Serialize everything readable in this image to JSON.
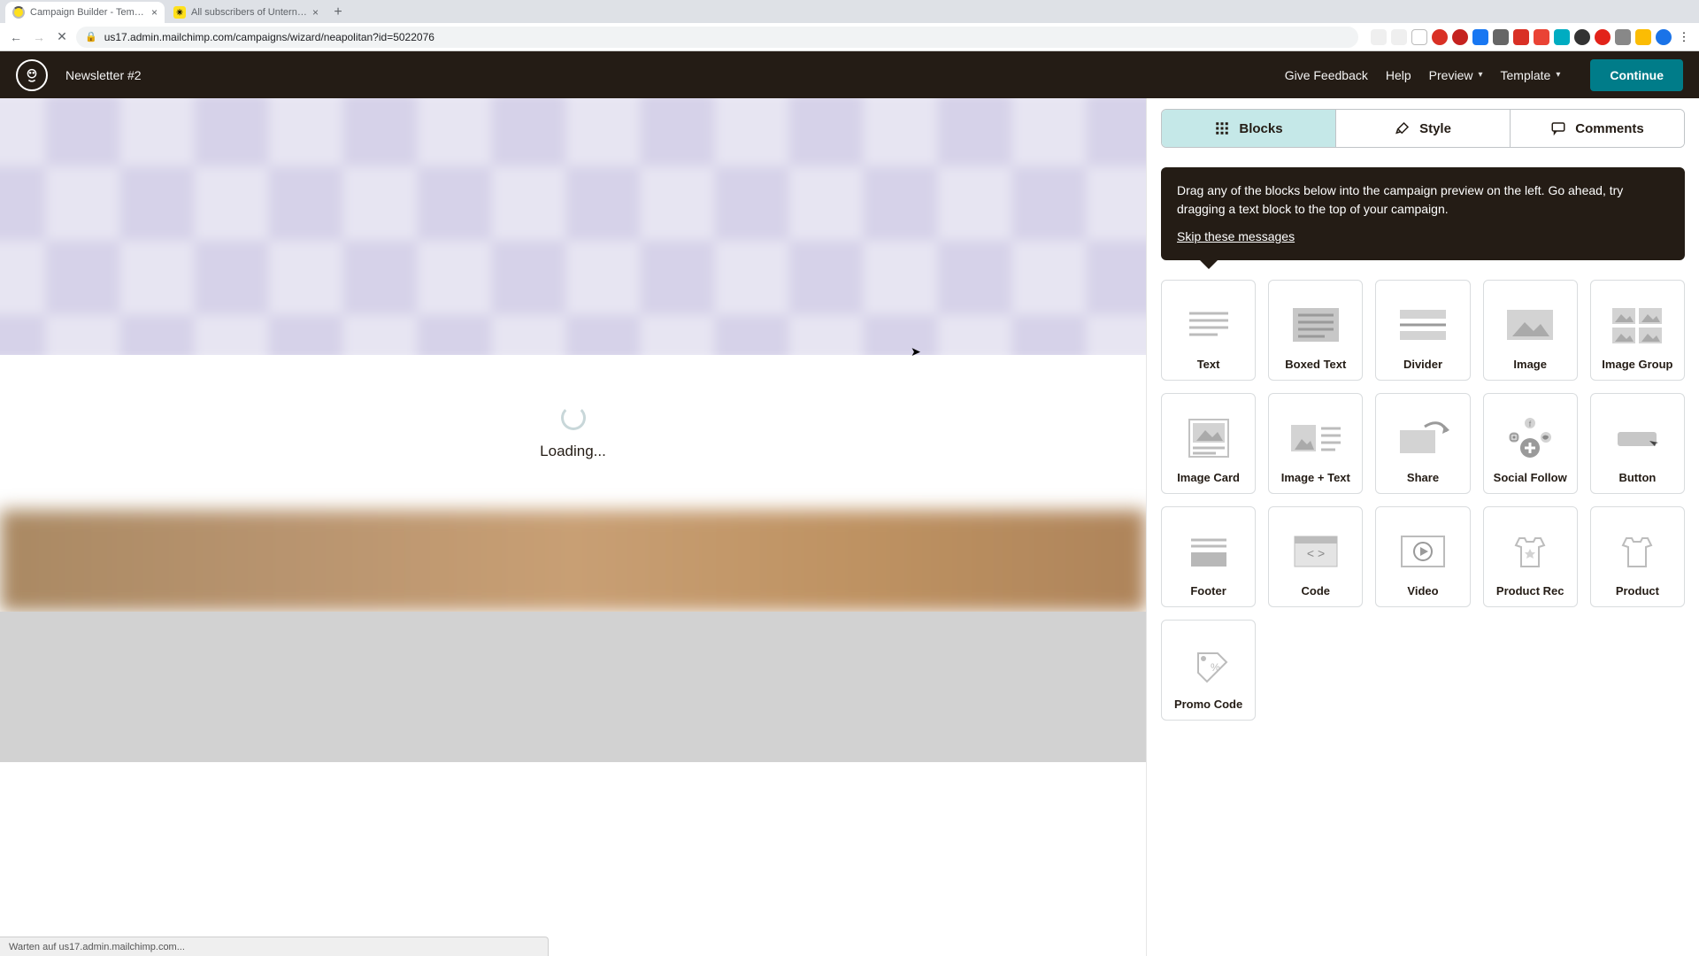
{
  "browser": {
    "tabs": [
      {
        "title": "Campaign Builder - Template D",
        "loading": true
      },
      {
        "title": "All subscribers of Unternehme",
        "loading": false
      }
    ],
    "url": "us17.admin.mailchimp.com/campaigns/wizard/neapolitan?id=5022076",
    "status_text": "Warten auf us17.admin.mailchimp.com..."
  },
  "header": {
    "doc_title": "Newsletter #2",
    "give_feedback": "Give Feedback",
    "help": "Help",
    "preview": "Preview",
    "template": "Template",
    "continue": "Continue"
  },
  "panel": {
    "tabs": {
      "blocks": "Blocks",
      "style": "Style",
      "comments": "Comments"
    },
    "tooltip_text": "Drag any of the blocks below into the campaign preview on the left. Go ahead, try dragging a text block to the top of your campaign.",
    "skip": "Skip these messages"
  },
  "preview": {
    "loading": "Loading..."
  },
  "blocks": [
    {
      "id": "text",
      "label": "Text"
    },
    {
      "id": "boxed-text",
      "label": "Boxed Text"
    },
    {
      "id": "divider",
      "label": "Divider"
    },
    {
      "id": "image",
      "label": "Image"
    },
    {
      "id": "image-group",
      "label": "Image Group"
    },
    {
      "id": "image-card",
      "label": "Image Card"
    },
    {
      "id": "image-text",
      "label": "Image + Text"
    },
    {
      "id": "share",
      "label": "Share"
    },
    {
      "id": "social",
      "label": "Social Follow"
    },
    {
      "id": "button",
      "label": "Button"
    },
    {
      "id": "footer",
      "label": "Footer"
    },
    {
      "id": "code",
      "label": "Code"
    },
    {
      "id": "video",
      "label": "Video"
    },
    {
      "id": "product-rec",
      "label": "Product Rec"
    },
    {
      "id": "product",
      "label": "Product"
    },
    {
      "id": "promo",
      "label": "Promo Code"
    }
  ]
}
